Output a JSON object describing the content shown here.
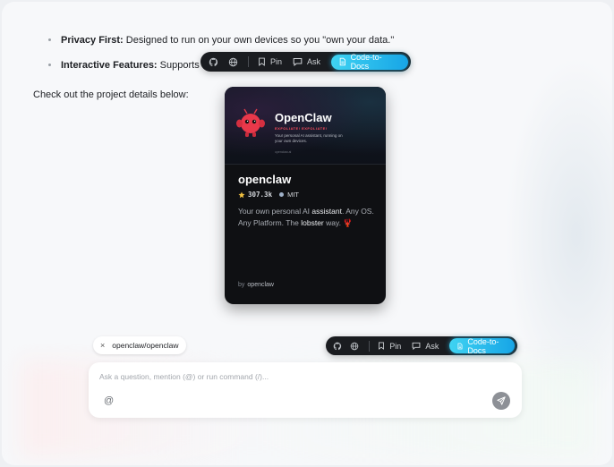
{
  "bullets": [
    {
      "bold": "Privacy First:",
      "text": " Designed to run on your own devices so you \"own your data.\""
    },
    {
      "bold": "Interactive Features:",
      "text": " Supports vo"
    }
  ],
  "details_text": "Check out the project details below:",
  "toolbar": {
    "pin_label": "Pin",
    "ask_label": "Ask",
    "cta_label": "Code-to-Docs",
    "icons": [
      "github-icon",
      "globe-icon",
      "pin-icon",
      "chat-icon",
      "document-icon"
    ]
  },
  "card": {
    "banner_title": "OpenClaw",
    "banner_tag": "EXFOLIATE! EXFOLIATE!",
    "banner_desc": "Your personal AI assistant, running on your own devices.",
    "banner_small": "openclaw.ai",
    "repo_name": "openclaw",
    "stars": "307.3k",
    "license": "MIT",
    "description_parts": [
      "Your own personal AI ",
      "assistant",
      ". Any OS. Any Platform. The ",
      "lobster",
      " way. 🦞"
    ],
    "by_label": "by",
    "owner": "openclaw",
    "colors": {
      "accent_red": "#ff4d5e",
      "star": "#f0c040"
    }
  },
  "chip": {
    "label": "openclaw/openclaw",
    "close_glyph": "×"
  },
  "composer": {
    "placeholder": "Ask a question, mention (@) or run command (/)...",
    "at_glyph": "@"
  },
  "colors": {
    "cta_start": "#3fd3f2",
    "cta_end": "#17a5e6",
    "toolbar_bg": "#1a1c20"
  }
}
